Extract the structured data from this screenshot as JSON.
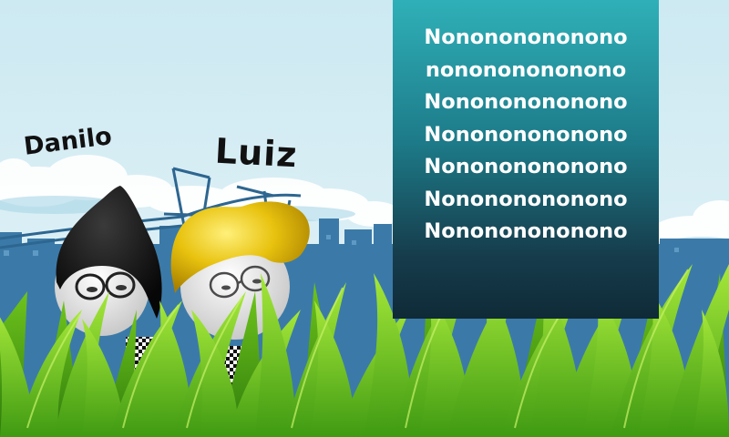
{
  "characters": {
    "left": {
      "name": "Danilo"
    },
    "right": {
      "name": "Luiz"
    }
  },
  "panel": {
    "lines": [
      "Nonononononono",
      "nonononononono",
      "Nonononononono",
      "Nonononononono",
      "Nonononononono",
      "Nonononononono",
      "Nonononononono"
    ]
  },
  "colors": {
    "sky": "#cfe9f2",
    "city": "#3b7aa8",
    "panel_top": "#2fb0b8",
    "panel_bottom": "#0f2a37",
    "grass": "#7ccf24",
    "hair_left": "#111111",
    "hair_right": "#e7c20c"
  }
}
